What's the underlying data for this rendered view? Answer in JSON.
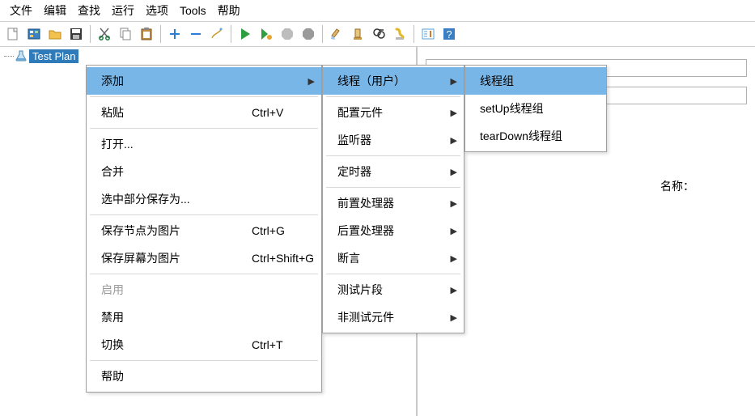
{
  "menubar": [
    "文件",
    "编辑",
    "查找",
    "运行",
    "选项",
    "Tools",
    "帮助"
  ],
  "tree": {
    "root": "Test Plan"
  },
  "right": {
    "name_label": "名称："
  },
  "menu1": [
    {
      "label": "添加",
      "shortcut": "",
      "arrow": true,
      "highlight": true
    },
    {
      "sep": true
    },
    {
      "label": "粘贴",
      "shortcut": "Ctrl+V"
    },
    {
      "sep": true
    },
    {
      "label": "打开...",
      "shortcut": ""
    },
    {
      "label": "合并",
      "shortcut": ""
    },
    {
      "label": "选中部分保存为...",
      "shortcut": ""
    },
    {
      "sep": true
    },
    {
      "label": "保存节点为图片",
      "shortcut": "Ctrl+G"
    },
    {
      "label": "保存屏幕为图片",
      "shortcut": "Ctrl+Shift+G"
    },
    {
      "sep": true
    },
    {
      "label": "启用",
      "shortcut": "",
      "disabled": true
    },
    {
      "label": "禁用",
      "shortcut": ""
    },
    {
      "label": "切换",
      "shortcut": "Ctrl+T"
    },
    {
      "sep": true
    },
    {
      "label": "帮助",
      "shortcut": ""
    }
  ],
  "menu2": [
    {
      "label": "线程（用户）",
      "arrow": true,
      "highlight": true
    },
    {
      "sep": true
    },
    {
      "label": "配置元件",
      "arrow": true
    },
    {
      "label": "监听器",
      "arrow": true
    },
    {
      "sep": true
    },
    {
      "label": "定时器",
      "arrow": true
    },
    {
      "sep": true
    },
    {
      "label": "前置处理器",
      "arrow": true
    },
    {
      "label": "后置处理器",
      "arrow": true
    },
    {
      "label": "断言",
      "arrow": true
    },
    {
      "sep": true
    },
    {
      "label": "测试片段",
      "arrow": true
    },
    {
      "label": "非测试元件",
      "arrow": true
    }
  ],
  "menu3": [
    {
      "label": "线程组",
      "highlight": true
    },
    {
      "label": "setUp线程组"
    },
    {
      "label": "tearDown线程组"
    }
  ],
  "icons": {
    "new": "file-new-icon",
    "templates": "templates-icon",
    "open": "folder-open-icon",
    "save": "save-icon",
    "cut": "cut-icon",
    "copy": "copy-icon",
    "paste": "paste-icon",
    "plus": "expand-icon",
    "minus": "collapse-icon",
    "wand": "toggle-icon",
    "run": "run-icon",
    "run-no-pause": "run-no-pause-icon",
    "stop": "stop-icon",
    "shutdown": "shutdown-icon",
    "clear": "clear-icon",
    "clear-all": "clear-all-icon",
    "search": "search-icon",
    "reset-search": "reset-search-icon",
    "function": "function-helper-icon",
    "help": "help-icon"
  }
}
